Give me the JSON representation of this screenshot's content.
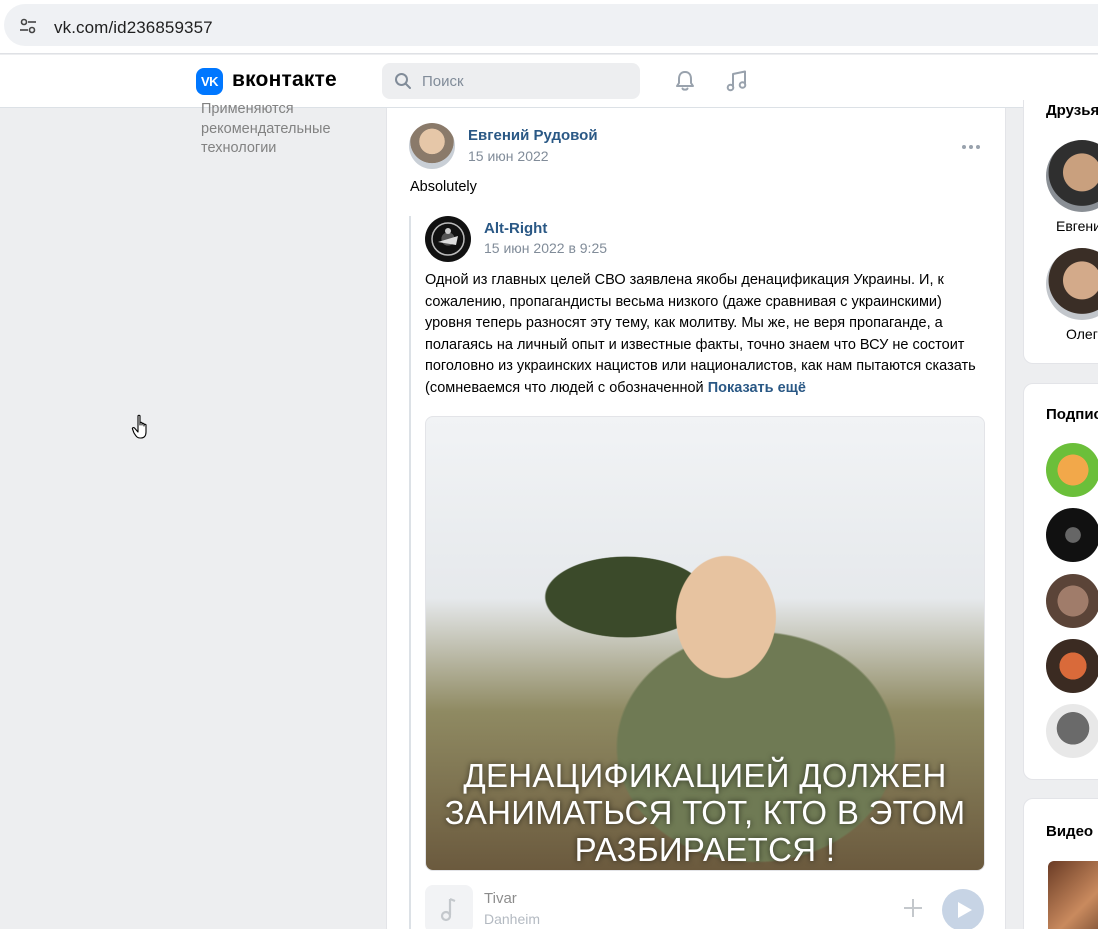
{
  "browser": {
    "url": "vk.com/id236859357"
  },
  "header": {
    "logo_text": "вконтакте",
    "search_placeholder": "Поиск"
  },
  "left": {
    "note": "Применяются рекомендательные технологии"
  },
  "post": {
    "author": "Евгений Рудовой",
    "date": "15 июн 2022",
    "text": "Absolutely",
    "repost": {
      "author": "Alt-Right",
      "date": "15 июн 2022 в 9:25",
      "text": "Одной из главных целей СВО заявлена якобы денацификация Украины. И, к сожалению, пропагандисты весьма низкого (даже сравнивая с украинскими) уровня теперь разносят эту тему, как молитву. Мы же, не веря пропаганде, а полагаясь на личный опыт и известные факты, точно знаем что ВСУ не состоит поголовно из украинских нацистов или националистов, как нам пытаются сказать (сомневаемся что людей с  обозначенной",
      "show_more": "Показать ещё",
      "image_caption": "ДЕНАЦИФИКАЦИЕЙ ДОЛЖЕН ЗАНИМАТЬСЯ ТОТ, КТО В ЭТОМ РАЗБИРАЕТСЯ !"
    },
    "audio": {
      "title": "Tivar",
      "artist": "Danheim"
    }
  },
  "right": {
    "friends_title": "Друзья",
    "friends": [
      "Евгени",
      "Олег"
    ],
    "subs_title": "Подпис",
    "videos_title": "Видео"
  },
  "colors": {
    "vk_blue": "#0077ff",
    "link": "#2a5885",
    "bg": "#edeef0"
  }
}
